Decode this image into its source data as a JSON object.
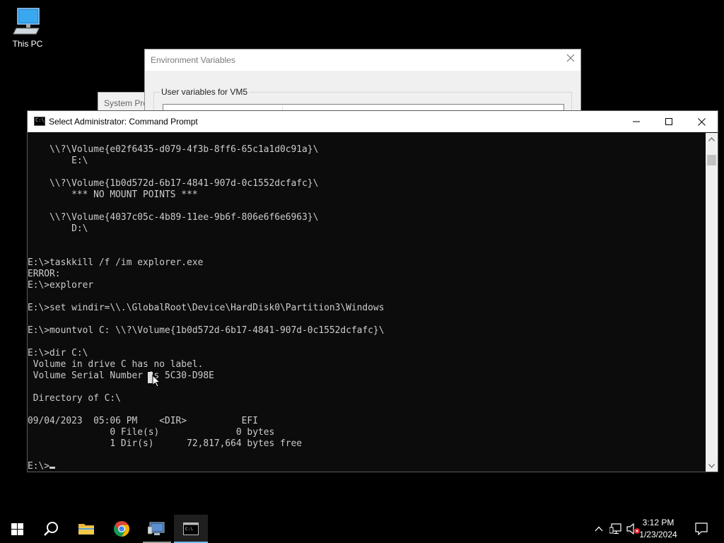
{
  "desktop": {
    "icons": [
      {
        "label": "This PC",
        "icon": "computer-icon"
      }
    ]
  },
  "background_windows": {
    "system_properties": {
      "title": "System Pro"
    },
    "environment_variables": {
      "title": "Environment Variables",
      "user_group_label": "User variables for VM5"
    }
  },
  "cmd_window": {
    "title": "Select Administrator: Command Prompt",
    "controls": {
      "minimize": "minimize-icon",
      "maximize": "maximize-icon",
      "close": "close-icon"
    },
    "console_lines": [
      "    \\\\?\\Volume{e02f6435-d079-4f3b-8ff6-65c1a1d0c91a}\\",
      "        E:\\",
      "",
      "    \\\\?\\Volume{1b0d572d-6b17-4841-907d-0c1552dcfafc}\\",
      "        *** NO MOUNT POINTS ***",
      "",
      "    \\\\?\\Volume{4037c05c-4b89-11ee-9b6f-806e6f6e6963}\\",
      "        D:\\",
      "",
      "",
      "E:\\>taskkill /f /im explorer.exe",
      "ERROR:",
      "E:\\>explorer",
      "",
      "E:\\>set windir=\\\\.\\GlobalRoot\\Device\\HardDisk0\\Partition3\\Windows",
      "",
      "E:\\>mountvol C: \\\\?\\Volume{1b0d572d-6b17-4841-907d-0c1552dcfafc}\\",
      "",
      "E:\\>dir C:\\",
      " Volume in drive C has no label.",
      " Volume Serial Number is 5C30-D98E",
      "",
      " Directory of C:\\",
      "",
      "09/04/2023  05:06 PM    <DIR>          EFI",
      "               0 File(s)              0 bytes",
      "               1 Dir(s)      72,817,664 bytes free",
      ""
    ],
    "prompt": "E:\\>"
  },
  "taskbar": {
    "items": [
      {
        "name": "start-button",
        "icon": "windows-logo-icon"
      },
      {
        "name": "search-button",
        "icon": "search-icon"
      },
      {
        "name": "file-explorer-button",
        "icon": "folder-icon"
      },
      {
        "name": "chrome-button",
        "icon": "chrome-icon"
      },
      {
        "name": "remote-app-button",
        "icon": "monitor-icon"
      },
      {
        "name": "cmd-taskbar-button",
        "icon": "cmd-icon"
      }
    ],
    "tray_icons": [
      "chevron-up-icon",
      "network-icon",
      "volume-muted-icon"
    ],
    "time": "3:12 PM",
    "date": "1/23/2024",
    "notification_icon": "notification-icon"
  }
}
